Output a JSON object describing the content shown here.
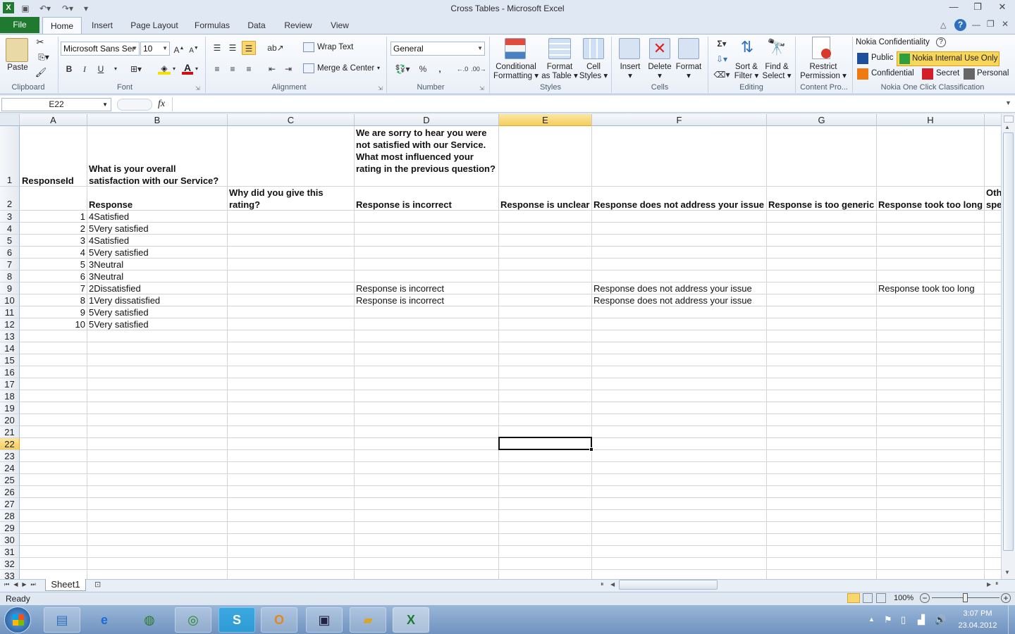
{
  "window": {
    "title": "Cross Tables  -  Microsoft Excel"
  },
  "tabs": [
    {
      "label": "File"
    },
    {
      "label": "Home"
    },
    {
      "label": "Insert"
    },
    {
      "label": "Page Layout"
    },
    {
      "label": "Formulas"
    },
    {
      "label": "Data"
    },
    {
      "label": "Review"
    },
    {
      "label": "View"
    }
  ],
  "ribbon": {
    "clipboard": {
      "paste": "Paste",
      "label": "Clipboard"
    },
    "font": {
      "name": "Microsoft Sans Ser",
      "size": "10",
      "label": "Font",
      "bold": "B",
      "italic": "I",
      "underline": "U"
    },
    "alignment": {
      "wrap_text": "Wrap Text",
      "merge_center": "Merge & Center",
      "label": "Alignment"
    },
    "number": {
      "format": "General",
      "percent": "%",
      "comma": ",",
      "label": "Number"
    },
    "styles": {
      "conditional_1": "Conditional",
      "conditional_2": "Formatting",
      "format_table_1": "Format",
      "format_table_2": "as Table",
      "cell_styles_1": "Cell",
      "cell_styles_2": "Styles",
      "label": "Styles"
    },
    "cells": {
      "insert": "Insert",
      "delete": "Delete",
      "format": "Format",
      "label": "Cells"
    },
    "editing": {
      "sigma": "Σ",
      "sort_1": "Sort &",
      "sort_2": "Filter",
      "find_1": "Find &",
      "find_2": "Select",
      "label": "Editing"
    },
    "content": {
      "restrict_1": "Restrict",
      "restrict_2": "Permission",
      "label": "Content Pro..."
    },
    "nokia": {
      "title": "Nokia Confidentiality",
      "public": "Public",
      "internal": "Nokia Internal Use Only",
      "confidential": "Confidential",
      "secret": "Secret",
      "personal": "Personal",
      "label": "Nokia One Click Classification"
    }
  },
  "formula_bar": {
    "name_box": "E22",
    "fx": "fx",
    "value": ""
  },
  "columns": [
    "A",
    "B",
    "C",
    "D",
    "E",
    "F",
    "G",
    "H"
  ],
  "header_row1": {
    "A": "ResponseId",
    "B": "What is your overall satisfaction with our Service?",
    "D": "We are sorry to hear you were not satisfied with our Service. What most influenced your rating in the previous question?"
  },
  "header_row2": {
    "B": "Response",
    "C": "Why did you give this rating?",
    "D": "Response is incorrect",
    "E": "Response is unclear",
    "F": "Response does not address your issue",
    "G": "Response is too generic",
    "H": "Response took too long",
    "I_top": "Oth",
    "I_bottom": "spe"
  },
  "rows": [
    {
      "A": "1",
      "B": "4Satisfied"
    },
    {
      "A": "2",
      "B": "5Very satisfied"
    },
    {
      "A": "3",
      "B": "4Satisfied"
    },
    {
      "A": "4",
      "B": "5Very satisfied"
    },
    {
      "A": "5",
      "B": "3Neutral"
    },
    {
      "A": "6",
      "B": "3Neutral"
    },
    {
      "A": "7",
      "B": "2Dissatisfied",
      "D": "Response is incorrect",
      "F": "Response does not address your issue",
      "H": "Response took too long"
    },
    {
      "A": "8",
      "B": "1Very dissatisfied",
      "D": "Response is incorrect",
      "F": "Response does not address your issue"
    },
    {
      "A": "9",
      "B": "5Very satisfied"
    },
    {
      "A": "10",
      "B": "5Very satisfied"
    }
  ],
  "row_numbers": [
    "1",
    "2",
    "3",
    "4",
    "5",
    "6",
    "7",
    "8",
    "9",
    "10",
    "11",
    "12",
    "13",
    "14",
    "15",
    "16",
    "17",
    "18",
    "19",
    "20",
    "21",
    "22",
    "23",
    "24",
    "25",
    "26",
    "27",
    "28",
    "29",
    "30",
    "31",
    "32",
    "33"
  ],
  "sheet": {
    "name": "Sheet1"
  },
  "status": {
    "text": "Ready",
    "zoom": "100%"
  },
  "clock": {
    "time": "3:07 PM",
    "date": "23.04.2012"
  }
}
